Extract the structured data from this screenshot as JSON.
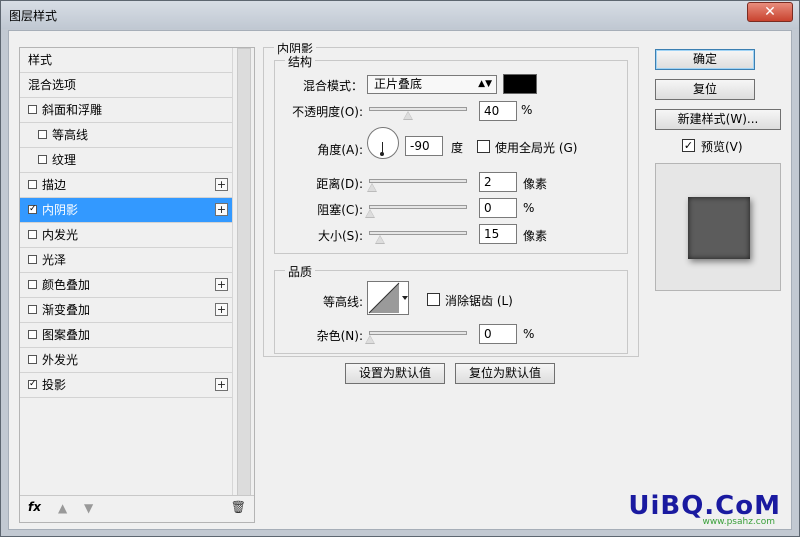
{
  "window": {
    "title": "图层样式",
    "close_glyph": "✕"
  },
  "left_panel": {
    "items": [
      {
        "label": "样式",
        "kind": "header",
        "checkbox": false,
        "checked": false,
        "plus": false,
        "indent": 0
      },
      {
        "label": "混合选项",
        "kind": "header",
        "checkbox": false,
        "checked": false,
        "plus": false,
        "indent": 0
      },
      {
        "label": "斜面和浮雕",
        "kind": "effect",
        "checkbox": true,
        "checked": false,
        "plus": false,
        "indent": 0
      },
      {
        "label": "等高线",
        "kind": "effect",
        "checkbox": true,
        "checked": false,
        "plus": false,
        "indent": 1
      },
      {
        "label": "纹理",
        "kind": "effect",
        "checkbox": true,
        "checked": false,
        "plus": false,
        "indent": 1
      },
      {
        "label": "描边",
        "kind": "effect",
        "checkbox": true,
        "checked": false,
        "plus": true,
        "indent": 0
      },
      {
        "label": "内阴影",
        "kind": "effect",
        "checkbox": true,
        "checked": true,
        "plus": true,
        "indent": 0,
        "selected": true
      },
      {
        "label": "内发光",
        "kind": "effect",
        "checkbox": true,
        "checked": false,
        "plus": false,
        "indent": 0
      },
      {
        "label": "光泽",
        "kind": "effect",
        "checkbox": true,
        "checked": false,
        "plus": false,
        "indent": 0
      },
      {
        "label": "颜色叠加",
        "kind": "effect",
        "checkbox": true,
        "checked": false,
        "plus": true,
        "indent": 0
      },
      {
        "label": "渐变叠加",
        "kind": "effect",
        "checkbox": true,
        "checked": false,
        "plus": true,
        "indent": 0
      },
      {
        "label": "图案叠加",
        "kind": "effect",
        "checkbox": true,
        "checked": false,
        "plus": false,
        "indent": 0
      },
      {
        "label": "外发光",
        "kind": "effect",
        "checkbox": true,
        "checked": false,
        "plus": false,
        "indent": 0
      },
      {
        "label": "投影",
        "kind": "effect",
        "checkbox": true,
        "checked": true,
        "plus": true,
        "indent": 0
      }
    ],
    "footer": {
      "fx": "fx",
      "up_icon": "arrow-up-icon",
      "down_icon": "arrow-down-icon",
      "trash_icon": "trash-icon"
    }
  },
  "inner_shadow": {
    "title": "内阴影",
    "structure": {
      "title": "结构",
      "blend_mode_label": "混合模式：",
      "blend_mode_value": "正片叠底",
      "color": "#000000",
      "opacity_label": "不透明度(O):",
      "opacity_value": "40",
      "opacity_unit": "%",
      "opacity_level": 0.4,
      "angle_label": "角度(A):",
      "angle_value": "-90",
      "angle_unit": "度",
      "global_light_label": "使用全局光 (G)",
      "global_light_checked": false,
      "distance_label": "距离(D):",
      "distance_value": "2",
      "distance_unit": "像素",
      "choke_label": "阻塞(C):",
      "choke_value": "0",
      "choke_unit": "%",
      "size_label": "大小(S):",
      "size_value": "15",
      "size_unit": "像素"
    },
    "quality": {
      "title": "品质",
      "contour_label": "等高线:",
      "antialias_label": "消除锯齿 (L)",
      "antialias_checked": false,
      "noise_label": "杂色(N):",
      "noise_value": "0",
      "noise_unit": "%"
    },
    "set_default_label": "设置为默认值",
    "reset_default_label": "复位为默认值"
  },
  "right_buttons": {
    "ok_label": "确定",
    "reset_label": "复位",
    "new_style_label": "新建样式(W)...",
    "preview_label": "预览(V)",
    "preview_checked": true
  },
  "watermark": {
    "text": "UiBQ.CoM",
    "sub": "www.psahz.com"
  },
  "colors": {
    "selected_row": "#3399ff",
    "preview_swatch": "#5c5c5c"
  }
}
